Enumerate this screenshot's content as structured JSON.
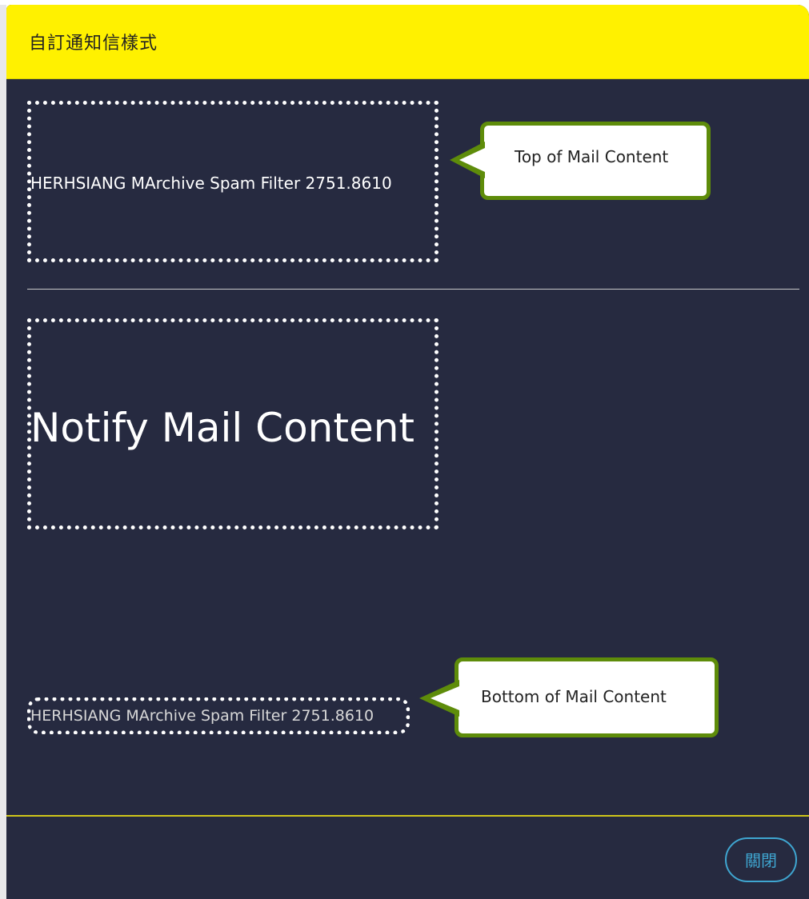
{
  "window": {
    "title": "自訂通知信樣式"
  },
  "top_section": {
    "header_text": "HERHSIANG MArchive Spam Filter 2751.8610",
    "callout_label": "Top of Mail Content"
  },
  "main_section": {
    "content_text": "Notify Mail Content"
  },
  "bottom_section": {
    "footer_text": "HERHSIANG MArchive Spam Filter 2751.8610",
    "callout_label": "Bottom of Mail Content"
  },
  "footer": {
    "close_label": "關閉"
  },
  "colors": {
    "header_bg": "#fff100",
    "dialog_bg": "#262a40",
    "callout_border": "#5e8c0a",
    "close_accent": "#3fa6d1"
  }
}
